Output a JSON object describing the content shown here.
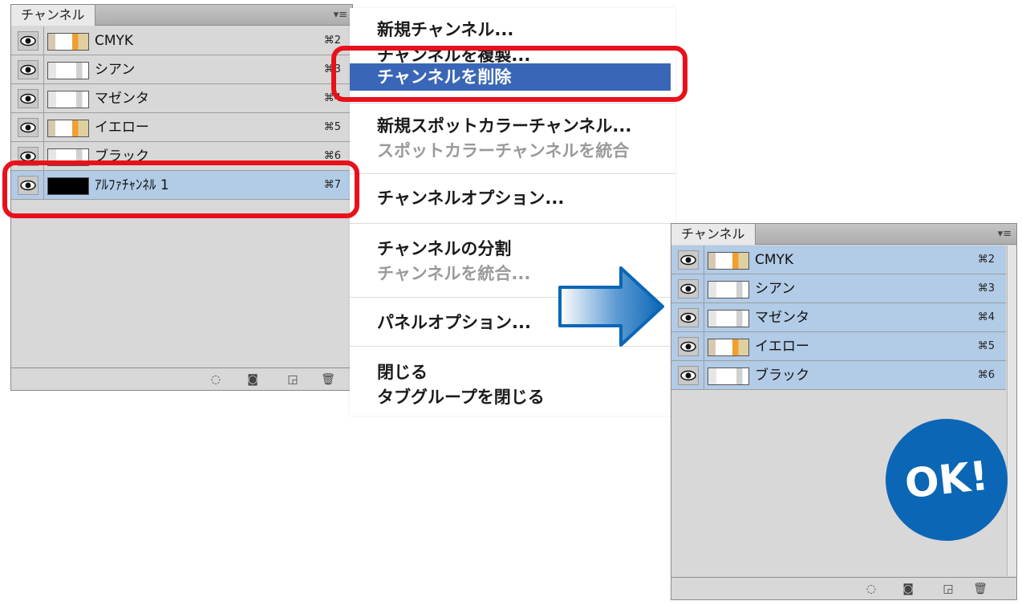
{
  "panel_before": {
    "tab_label": "チャンネル",
    "menu_icon": "panel-menu-icon",
    "channels": [
      {
        "name": "CMYK",
        "shortcut": "⌘2",
        "thumb": "color"
      },
      {
        "name": "シアン",
        "shortcut": "⌘3",
        "thumb": "gray"
      },
      {
        "name": "マゼンタ",
        "shortcut": "⌘4",
        "thumb": "gray"
      },
      {
        "name": "イエロー",
        "shortcut": "⌘5",
        "thumb": "color"
      },
      {
        "name": "ブラック",
        "shortcut": "⌘6",
        "thumb": "gray"
      },
      {
        "name": "ｱﾙﾌｧﾁｬﾝﾈﾙ 1",
        "shortcut": "⌘7",
        "thumb": "black",
        "selected": true
      }
    ],
    "footer_icons": [
      "load-selection-icon",
      "save-selection-icon",
      "new-channel-icon",
      "trash-icon"
    ]
  },
  "menu": {
    "items": [
      {
        "label": "新規チャンネル...",
        "state": "normal"
      },
      {
        "label": "チャンネルを複製...",
        "state": "normal"
      },
      {
        "label": "チャンネルを削除",
        "state": "highlight"
      },
      {
        "label": "新規スポットカラーチャンネル...",
        "state": "normal"
      },
      {
        "label": "スポットカラーチャンネルを統合",
        "state": "disabled"
      },
      {
        "label": "チャンネルオプション...",
        "state": "normal"
      },
      {
        "label": "チャンネルの分割",
        "state": "normal"
      },
      {
        "label": "チャンネルを統合...",
        "state": "disabled"
      },
      {
        "label": "パネルオプション...",
        "state": "normal"
      },
      {
        "label": "閉じる",
        "state": "normal"
      },
      {
        "label": "タブグループを閉じる",
        "state": "normal"
      }
    ],
    "highlight_color": "#3a66b7"
  },
  "panel_after": {
    "tab_label": "チャンネル",
    "menu_icon": "panel-menu-icon",
    "channels": [
      {
        "name": "CMYK",
        "shortcut": "⌘2",
        "thumb": "color",
        "selected": true
      },
      {
        "name": "シアン",
        "shortcut": "⌘3",
        "thumb": "gray",
        "selected": true
      },
      {
        "name": "マゼンタ",
        "shortcut": "⌘4",
        "thumb": "gray",
        "selected": true
      },
      {
        "name": "イエロー",
        "shortcut": "⌘5",
        "thumb": "color",
        "selected": true
      },
      {
        "name": "ブラック",
        "shortcut": "⌘6",
        "thumb": "gray",
        "selected": true
      }
    ],
    "footer_icons": [
      "load-selection-icon",
      "save-selection-icon",
      "new-channel-icon",
      "trash-icon"
    ]
  },
  "ok_badge": {
    "label": "OK!",
    "color": "#0b66b6"
  },
  "arrow": {
    "icon": "right-arrow-icon",
    "color": "#0b66b6"
  },
  "callout_color": "#e8101a"
}
